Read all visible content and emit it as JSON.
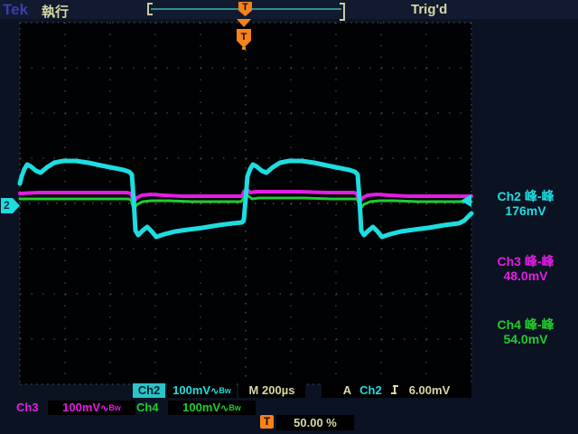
{
  "colors": {
    "cyan": "#1edde0",
    "magenta": "#e31ee3",
    "green": "#21cc2e",
    "beige": "#d6d8a6",
    "orange": "#f5821f",
    "tek_blue": "#3a3fae",
    "screen_bg": "#010204",
    "frame_bg": "#0b1222"
  },
  "header": {
    "logo": "Tek",
    "run_status": "執行",
    "trigger_status": "Trig'd",
    "record_marker": "T"
  },
  "trigger_flag": {
    "label": "T"
  },
  "channel_marker": {
    "label": "2"
  },
  "measurements": [
    {
      "channel": "Ch2",
      "label": "峰-峰",
      "value": "176mV"
    },
    {
      "channel": "Ch3",
      "label": "峰-峰",
      "value": "48.0mV"
    },
    {
      "channel": "Ch4",
      "label": "峰-峰",
      "value": "54.0mV"
    }
  ],
  "readouts": {
    "ch2": {
      "name": "Ch2",
      "scale": "100mV",
      "coupling": "∿",
      "bandwidth": "Bw"
    },
    "timebase": {
      "prefix": "M",
      "value": "200µs"
    },
    "trigger": {
      "mode": "A",
      "source": "Ch2",
      "level": "6.00mV"
    },
    "ch3": {
      "name": "Ch3",
      "scale": "100mV",
      "coupling": "∿",
      "bandwidth": "Bw"
    },
    "ch4": {
      "name": "Ch4",
      "scale": "100mV",
      "coupling": "∿",
      "bandwidth": "Bw"
    },
    "horizontal": {
      "marker": "T",
      "value": "50.00 %"
    }
  },
  "waveforms": {
    "ch2_points": "0,178 2,170 5,162 8,157 12,159 18,164 23,166 30,160 38,155 48,153 62,153 76,155 90,158 105,161 115,163 121,165 124,168 126,195 128,230 131,235 136,230 141,226 146,231 151,237 160,234 172,231 186,229 202,227 220,224 236,222 246,221 248,218 250,195 252,170 255,162 258,157 262,159 268,164 273,166 280,160 288,155 298,153 312,153 326,155 340,158 355,161 365,163 371,165 374,168 376,195 378,230 381,235 386,230 391,226 396,231 401,237 410,234 422,231 436,229 452,227 470,224 486,222 492,219 497,214 500,211",
    "ch3_points": "0,189 20,188 60,188 100,188 118,188 123,189 126,199 129,194 135,191 145,190 160,191 180,192 210,192 240,192 246,192 248,187 251,184 255,188 262,187 280,187 310,187 340,188 360,188 370,188 373,189 376,199 379,194 385,191 395,190 410,191 430,192 460,192 490,192 500,192",
    "ch4_points": "0,195 30,195 70,195 110,195 120,195 123,196 126,206 130,201 136,198 146,197 165,197 190,198 220,198 245,198 248,194 252,191 257,195 265,194 285,194 315,194 345,195 365,195 372,195 374,196 377,206 381,201 388,198 398,197 415,197 440,198 470,198 500,198"
  }
}
